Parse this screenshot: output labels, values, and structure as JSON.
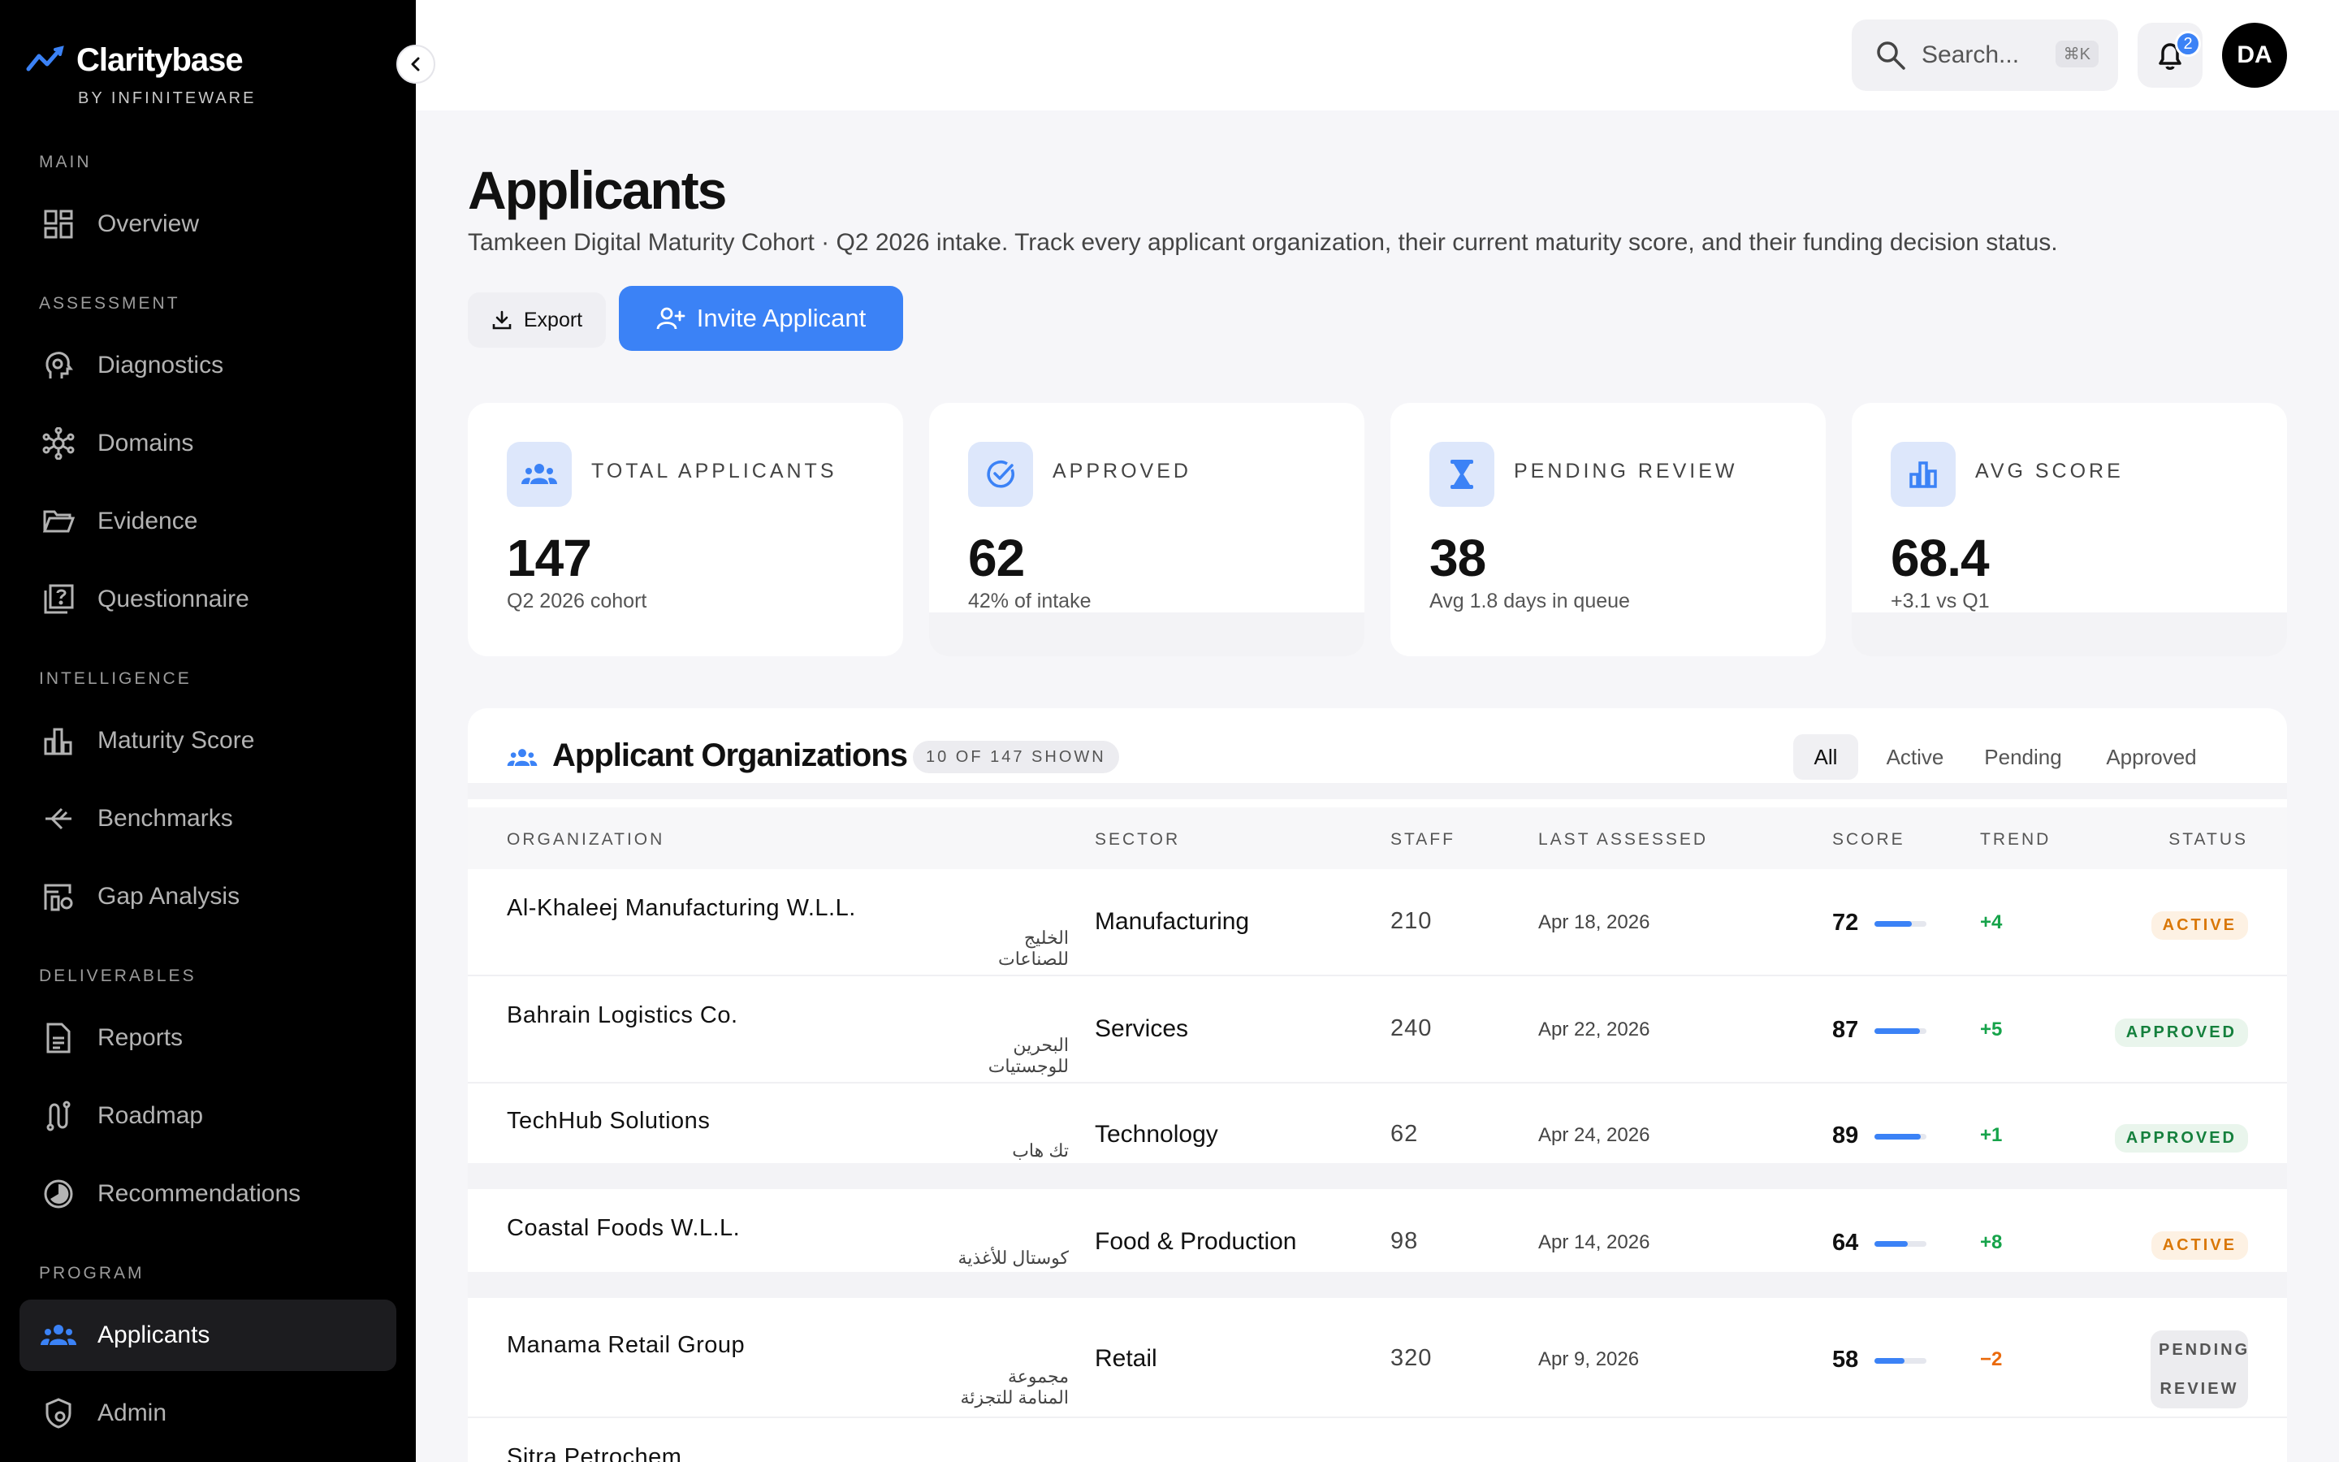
{
  "app": {
    "name": "Claritybase",
    "subtitle": "BY INFINITEWARE"
  },
  "sidebar": {
    "sections": [
      {
        "label": "MAIN",
        "items": [
          {
            "label": "Overview",
            "icon": "grid-icon"
          }
        ]
      },
      {
        "label": "ASSESSMENT",
        "items": [
          {
            "label": "Diagnostics",
            "icon": "diagnostics-icon"
          },
          {
            "label": "Domains",
            "icon": "network-icon"
          },
          {
            "label": "Evidence",
            "icon": "folder-icon"
          },
          {
            "label": "Questionnaire",
            "icon": "question-icon"
          }
        ]
      },
      {
        "label": "INTELLIGENCE",
        "items": [
          {
            "label": "Maturity Score",
            "icon": "bar-chart-icon"
          },
          {
            "label": "Benchmarks",
            "icon": "compare-icon"
          },
          {
            "label": "Gap Analysis",
            "icon": "gap-icon"
          }
        ]
      },
      {
        "label": "DELIVERABLES",
        "items": [
          {
            "label": "Reports",
            "icon": "document-icon"
          },
          {
            "label": "Roadmap",
            "icon": "route-icon"
          },
          {
            "label": "Recommendations",
            "icon": "pie-icon"
          }
        ]
      },
      {
        "label": "PROGRAM",
        "items": [
          {
            "label": "Applicants",
            "icon": "users-icon",
            "active": true
          },
          {
            "label": "Admin",
            "icon": "shield-icon"
          }
        ]
      }
    ]
  },
  "topbar": {
    "search_placeholder": "Search...",
    "search_shortcut": "⌘K",
    "notifications_count": "2",
    "avatar_initials": "DA"
  },
  "page": {
    "title": "Applicants",
    "subtitle": "Tamkeen Digital Maturity Cohort · Q2 2026 intake. Track every applicant organization, their current maturity score, and their funding decision status.",
    "export_label": "Export",
    "invite_label": "Invite Applicant"
  },
  "stats": [
    {
      "label": "TOTAL APPLICANTS",
      "value": "147",
      "sub": "Q2 2026 cohort",
      "icon": "users-icon"
    },
    {
      "label": "APPROVED",
      "value": "62",
      "sub": "42% of intake",
      "icon": "check-circle-icon"
    },
    {
      "label": "PENDING REVIEW",
      "value": "38",
      "sub": "Avg 1.8 days in queue",
      "icon": "hourglass-icon"
    },
    {
      "label": "AVG SCORE",
      "value": "68.4",
      "sub": "+3.1 vs Q1",
      "icon": "bar-chart-icon"
    }
  ],
  "table": {
    "title": "Applicant Organizations",
    "shown": "10 OF 147 SHOWN",
    "filters": [
      "All",
      "Active",
      "Pending",
      "Approved"
    ],
    "active_filter": "All",
    "columns": [
      "ORGANIZATION",
      "SECTOR",
      "STAFF",
      "LAST ASSESSED",
      "SCORE",
      "TREND",
      "STATUS"
    ],
    "rows": [
      {
        "name": "Al-Khaleej Manufacturing W.L.L.",
        "arabic": "الخليج للصناعات",
        "sector": "Manufacturing",
        "staff": "210",
        "date": "Apr 18, 2026",
        "score": "72",
        "score_pct": 72,
        "trend": "+4",
        "trend_dir": "up",
        "status": "ACTIVE",
        "status_kind": "active"
      },
      {
        "name": "Bahrain Logistics Co.",
        "arabic": "البحرين للوجستيات",
        "sector": "Services",
        "staff": "240",
        "date": "Apr 22, 2026",
        "score": "87",
        "score_pct": 87,
        "trend": "+5",
        "trend_dir": "up",
        "status": "APPROVED",
        "status_kind": "approved"
      },
      {
        "name": "TechHub Solutions",
        "arabic": "تك هاب",
        "sector": "Technology",
        "staff": "62",
        "date": "Apr 24, 2026",
        "score": "89",
        "score_pct": 89,
        "trend": "+1",
        "trend_dir": "up",
        "status": "APPROVED",
        "status_kind": "approved"
      },
      {
        "name": "Coastal Foods W.L.L.",
        "arabic": "كوستال للأغذية",
        "sector": "Food & Production",
        "staff": "98",
        "date": "Apr 14, 2026",
        "score": "64",
        "score_pct": 64,
        "trend": "+8",
        "trend_dir": "up",
        "status": "ACTIVE",
        "status_kind": "active"
      },
      {
        "name": "Manama Retail Group",
        "arabic": "مجموعة المنامة للتجزئة",
        "sector": "Retail",
        "staff": "320",
        "date": "Apr 9, 2026",
        "score": "58",
        "score_pct": 58,
        "trend": "−2",
        "trend_dir": "down",
        "status_line1": "PENDING",
        "status_line2": "REVIEW",
        "status_kind": "pending"
      },
      {
        "name": "Sitra Petrochem"
      }
    ]
  },
  "colors": {
    "accent": "#3b82f6",
    "sidebar_bg": "#000000",
    "positive": "#16a34a",
    "negative": "#ea6a0c"
  }
}
